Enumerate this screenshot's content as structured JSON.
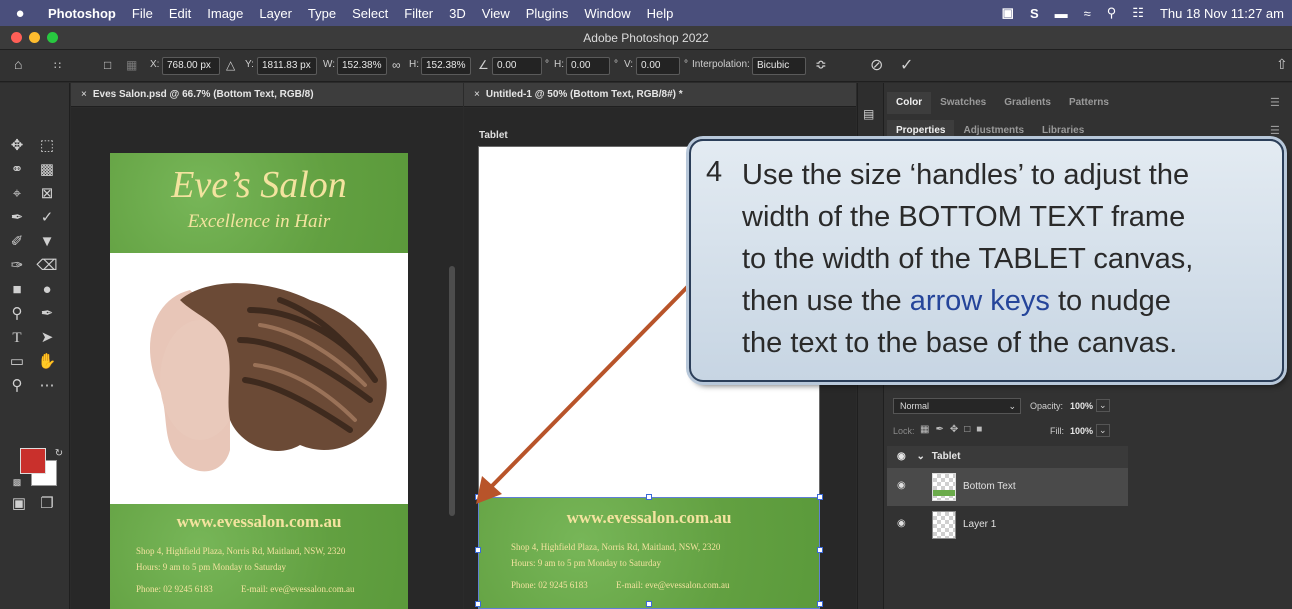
{
  "menubar": {
    "apple": "",
    "items": [
      "Photoshop",
      "File",
      "Edit",
      "Image",
      "Layer",
      "Type",
      "Select",
      "Filter",
      "3D",
      "View",
      "Plugins",
      "Window",
      "Help"
    ],
    "clock": "Thu 18 Nov  11:27 am"
  },
  "window": {
    "title": "Adobe Photoshop 2022"
  },
  "options": {
    "x_label": "X:",
    "x": "768.00 px",
    "y_label": "Y:",
    "y": "1811.83 px",
    "w_label": "W:",
    "w": "152.38%",
    "h_label": "H:",
    "h": "152.38%",
    "angle": "0.00",
    "hskew_label": "H:",
    "hskew": "0.00",
    "vskew_label": "V:",
    "vskew": "0.00",
    "interp_label": "Interpolation:",
    "interp": "Bicubic"
  },
  "tabs": {
    "left": "Eves Salon.psd @ 66.7% (Bottom Text, RGB/8)",
    "right": "Untitled-1 @ 50% (Bottom Text, RGB/8#) *"
  },
  "artboard": {
    "label": "Tablet"
  },
  "poster": {
    "title": "Eve’s Salon",
    "subtitle": "Excellence in Hair",
    "website": "www.evessalon.com.au",
    "address": "Shop 4, Highfield Plaza, Norris Rd, Maitland, NSW, 2320",
    "hours": "Hours:  9 am to 5 pm Monday to Saturday",
    "phone": "Phone:  02 9245 6183",
    "email": "E-mail:  eve@evessalon.com.au"
  },
  "panels": {
    "top_tabs": [
      "Color",
      "Swatches",
      "Gradients",
      "Patterns"
    ],
    "mid_tabs": [
      "Properties",
      "Adjustments",
      "Libraries"
    ],
    "blend_mode": "Normal",
    "opacity_label": "Opacity:",
    "opacity": "100%",
    "lock_label": "Lock:",
    "fill_label": "Fill:",
    "fill": "100%",
    "group": "Tablet",
    "layers": [
      "Bottom Text",
      "Layer 1"
    ]
  },
  "callout": {
    "number": "4",
    "line1": "Use the size ‘handles’ to adjust the",
    "line2": "width of the BOTTOM TEXT frame",
    "line3": "to the width of the TABLET canvas,",
    "line4_a": "then use the ",
    "line4_hl": "arrow keys",
    "line4_b": " to nudge",
    "line5": "the text to the base of the canvas."
  },
  "colors": {
    "menubar": "#4a4f7c",
    "poster_green": "#6bab4b",
    "poster_text": "#f3e39f",
    "foreground": "#c9302c",
    "arrow": "#b8542a"
  }
}
